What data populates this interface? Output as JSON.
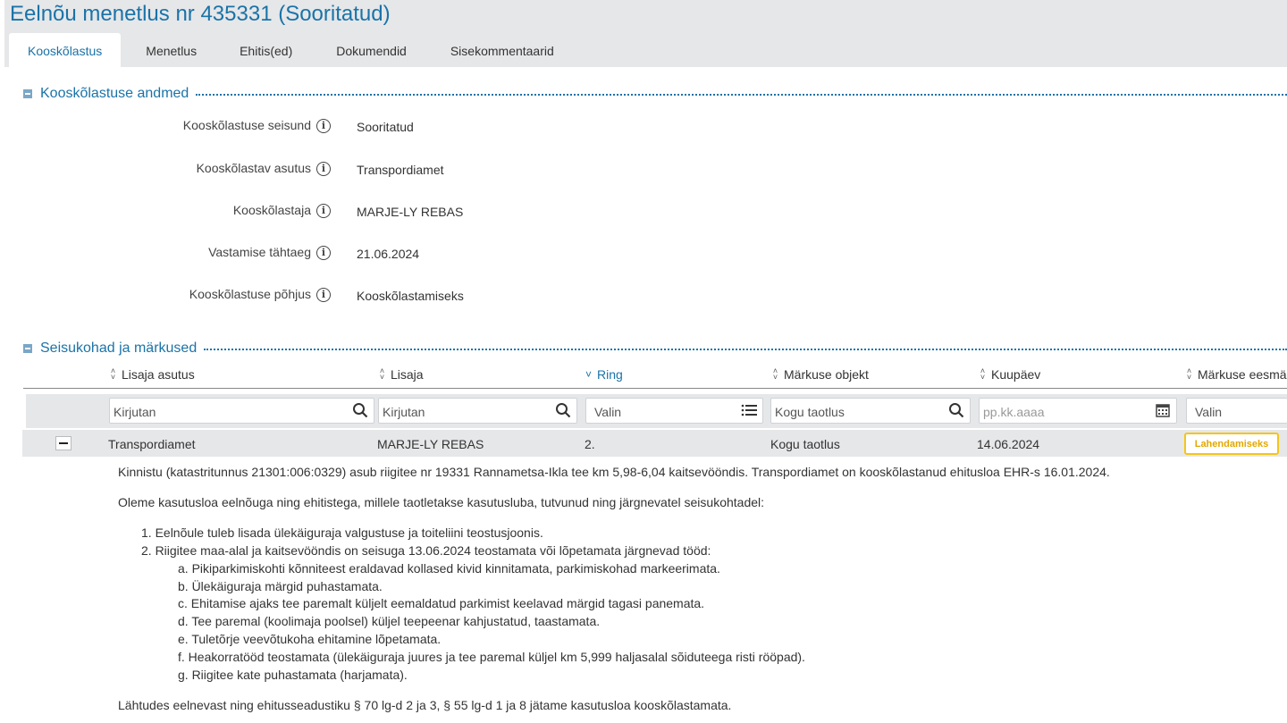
{
  "page": {
    "title": "Eelnõu menetlus nr 435331 (Sooritatud)"
  },
  "tabs": [
    "Kooskõlastus",
    "Menetlus",
    "Ehitis(ed)",
    "Dokumendid",
    "Sisekommentaarid"
  ],
  "section1": {
    "title": "Kooskõlastuse andmed",
    "fields": [
      {
        "label": "Kooskõlastuse seisund",
        "value": "Sooritatud"
      },
      {
        "label": "Kooskõlastav asutus",
        "value": "Transpordiamet"
      },
      {
        "label": "Kooskõlastaja",
        "value": "MARJE-LY REBAS"
      },
      {
        "label": "Vastamise tähtaeg",
        "value": "21.06.2024"
      },
      {
        "label": "Kooskõlastuse põhjus",
        "value": "Kooskõlastamiseks"
      }
    ]
  },
  "section2": {
    "title": "Seisukohad ja märkused",
    "columns": [
      "Lisaja asutus",
      "Lisaja",
      "Ring",
      "Märkuse objekt",
      "Kuupäev",
      "Märkuse eesmä"
    ],
    "filters": [
      "Kirjutan",
      "Kirjutan",
      "Valin",
      "Kogu taotlus",
      "pp.kk.aaaa",
      "Valin"
    ],
    "row": {
      "asutus": "Transpordiamet",
      "lisaja": "MARJE-LY REBAS",
      "ring": "2.",
      "objekt": "Kogu taotlus",
      "kuupaev": "14.06.2024",
      "eesmark": "Lahendamiseks"
    },
    "comment": {
      "p1": "Kinnistu (katastritunnus 21301:006:0329) asub riigitee nr 19331 Rannametsa-Ikla tee km 5,98-6,04 kaitsevööndis. Transpordiamet on kooskõlastanud  ehitusloa EHR-s 16.01.2024.",
      "p2": "Oleme kasutusloa eelnõuga ning ehitistega, millele taotletakse kasutusluba, tutvunud ning järgnevatel seisukohtadel:",
      "list": [
        "1. Eelnõule tuleb lisada ülekäiguraja valgustuse ja toiteliini teostusjoonis.",
        "2. Riigitee maa-alal ja kaitsevööndis on seisuga 13.06.2024 teostamata või lõpetamata järgnevad tööd:"
      ],
      "sublist": [
        "a. Pikiparkimiskohti kõnniteest eraldavad kollased kivid kinnitamata, parkimiskohad markeerimata.",
        "b. Ülekäiguraja märgid puhastamata.",
        "c. Ehitamise ajaks tee paremalt küljelt eemaldatud parkimist keelavad märgid tagasi panemata.",
        "d. Tee paremal (koolimaja poolsel) küljel teepeenar kahjustatud, taastamata.",
        "e. Tuletõrje veevõtukoha ehitamine lõpetamata.",
        "f. Heakorratööd teostamata (ülekäiguraja juures ja tee paremal küljel km 5,999 haljasalal sõiduteega risti rööpad).",
        "g. Riigitee kate puhastamata (harjamata)."
      ],
      "p3": "Lähtudes eelnevast ning ehitusseadustiku § 70 lg-d 2 ja 3, § 55 lg-d 1 ja 8 jätame kasutusloa kooskõlastamata."
    }
  }
}
